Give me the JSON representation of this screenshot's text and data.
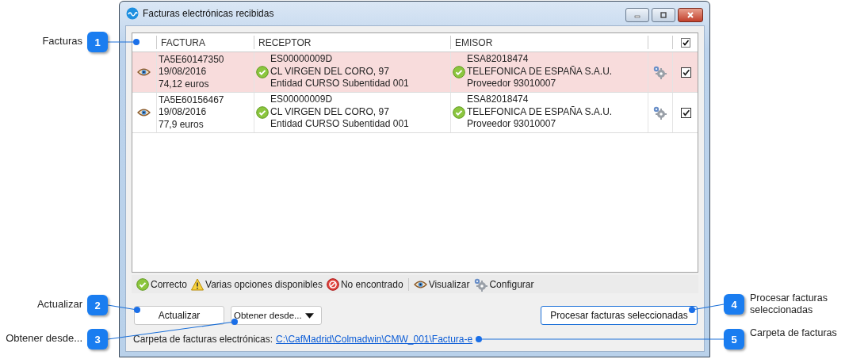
{
  "window": {
    "title": "Facturas electrónicas recibidas"
  },
  "table": {
    "columns": [
      "FACTURA",
      "RECEPTOR",
      "EMISOR"
    ],
    "header_checkbox": {
      "checked": true
    },
    "rows": [
      {
        "selected": true,
        "factura": [
          "TA5E60147350",
          "19/08/2016",
          "74,12 euros"
        ],
        "receptor": {
          "kind": "ok",
          "lines": [
            "ES00000009D",
            "CL VIRGEN DEL CORO, 97",
            "Entidad CURSO Subentidad 001"
          ]
        },
        "emisor": {
          "kind": "ok",
          "lines": [
            "ESA82018474",
            "TELEFONICA DE ESPAÑA S.A.U.",
            "Proveedor 93010007"
          ]
        },
        "checked": true
      },
      {
        "selected": false,
        "factura": [
          "TA5E60156467",
          "19/08/2016",
          "77,9 euros"
        ],
        "receptor": {
          "kind": "ok",
          "lines": [
            "ES00000009D",
            "CL VIRGEN DEL CORO, 97",
            "Entidad CURSO Subentidad 001"
          ]
        },
        "emisor": {
          "kind": "ok",
          "lines": [
            "ESA82018474",
            "TELEFONICA DE ESPAÑA S.A.U.",
            "Proveedor 93010007"
          ]
        },
        "checked": true
      }
    ]
  },
  "legend": {
    "groups": [
      [
        {
          "kind": "ok",
          "label": "Correcto"
        },
        {
          "kind": "warning",
          "label": "Varias opciones disponibles"
        },
        {
          "kind": "error",
          "label": "No encontrado"
        }
      ],
      [
        {
          "kind": "view",
          "label": "Visualizar"
        },
        {
          "kind": "config",
          "label": "Configurar"
        }
      ]
    ]
  },
  "buttons": [
    {
      "kind": "plain",
      "label": "Actualizar"
    },
    {
      "kind": "dropdown",
      "label": "Obtener desde..."
    },
    {
      "kind": "primary",
      "label": "Procesar facturas seleccionadas"
    }
  ],
  "folder": {
    "label": "Carpeta de facturas electrónicas:",
    "path": "C:\\CafMadrid\\Colmadwin\\CMW_001\\Factura-e"
  },
  "callouts": [
    {
      "number": "1",
      "label": "Facturas",
      "kind": "left"
    },
    {
      "number": "2",
      "label": "Actualizar",
      "kind": "left"
    },
    {
      "number": "3",
      "label": "Obtener desde...",
      "kind": "left"
    },
    {
      "number": "4",
      "label": "Procesar facturas seleccionadas",
      "kind": "right"
    },
    {
      "number": "5",
      "label": "Carpeta de facturas",
      "kind": "right"
    }
  ]
}
